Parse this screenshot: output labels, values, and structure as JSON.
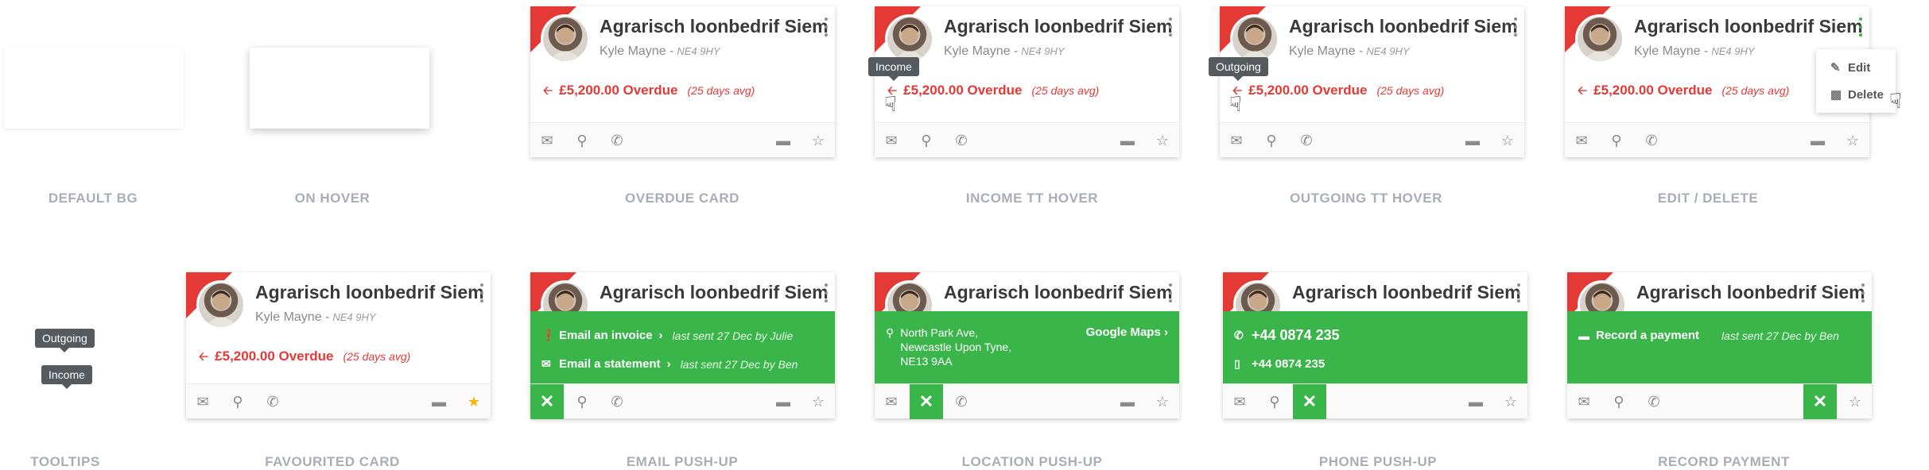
{
  "labels": {
    "default_bg": "DEFAULT BG",
    "on_hover": "ON HOVER",
    "overdue_card": "OVERDUE CARD",
    "income_tt_hover": "INCOME TT HOVER",
    "outgoing_tt_hover": "OUTGOING TT HOVER",
    "edit_delete": "EDIT / DELETE",
    "tooltips": "TOOLTIPS",
    "favourited_card": "FAVOURITED CARD",
    "email_pushup": "EMAIL PUSH-UP",
    "location_pushup": "LOCATION PUSH-UP",
    "phone_pushup": "PHONE PUSH-UP",
    "record_payment": "RECORD PAYMENT"
  },
  "card": {
    "name": "Agrarisch loonbedrif Siem",
    "contact": "Kyle Mayne -",
    "postcode": "NE4 9HY",
    "overdue_amount": "£5,200.00 Overdue",
    "overdue_avg": "(25 days avg)"
  },
  "tooltips": {
    "income": "Income",
    "outgoing": "Outgoing"
  },
  "menu": {
    "edit": "Edit",
    "delete": "Delete"
  },
  "email_pushup": {
    "invoice_label": "Email an invoice",
    "invoice_note": "last sent 27 Dec by Julie",
    "statement_label": "Email a statement",
    "statement_note": "last sent 27 Dec by Ben"
  },
  "location_pushup": {
    "line1": "North Park Ave,",
    "line2": "Newcastle Upon Tyne,",
    "line3": "NE13 9AA",
    "maps_link": "Google Maps"
  },
  "phone_pushup": {
    "primary": "+44 0874 235",
    "mobile": "+44 0874 235"
  },
  "record_pushup": {
    "label": "Record a payment",
    "note": "last sent 27 Dec by Ben"
  },
  "icons": {
    "mail": "mail-icon",
    "pin": "map-pin-icon",
    "phone": "phone-icon",
    "card": "credit-card-icon",
    "star": "star-icon",
    "close": "close-icon",
    "kebab": "kebab-menu-icon"
  },
  "colors": {
    "overdue_red": "#e53935",
    "pushup_green": "#3ab54a",
    "favourite_gold": "#f5b800",
    "label_grey": "#a8adb8",
    "tooltip_bg": "#555a5f"
  }
}
